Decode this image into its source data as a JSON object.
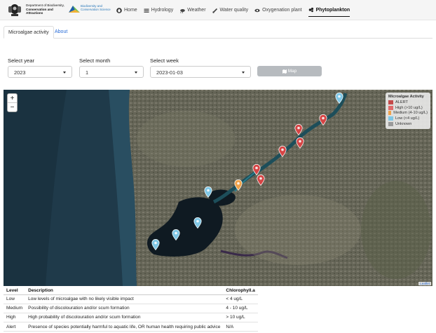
{
  "header": {
    "dept_lines": [
      "Department of Biodiversity,",
      "Conservation and Attractions"
    ],
    "bcs_lines": [
      "Biodiversity and",
      "Conservation Science"
    ],
    "nav": [
      {
        "label": "Home",
        "icon": "home-icon"
      },
      {
        "label": "Hydrology",
        "icon": "hydrology-icon"
      },
      {
        "label": "Weather",
        "icon": "weather-icon"
      },
      {
        "label": "Water quality",
        "icon": "water-quality-icon"
      },
      {
        "label": "Oxygenation plant",
        "icon": "oxygenation-icon"
      },
      {
        "label": "Phytoplankton",
        "icon": "phytoplankton-icon",
        "active": true
      }
    ]
  },
  "tabs": {
    "active": "Microalgae activity",
    "other": "About"
  },
  "filters": {
    "year": {
      "label": "Select year",
      "value": "2023"
    },
    "month": {
      "label": "Select month",
      "value": "1"
    },
    "week": {
      "label": "Select week",
      "value": "2023-01-03"
    },
    "map_button": "Map"
  },
  "map": {
    "zoom_in": "+",
    "zoom_out": "−",
    "attribution": "Leaflet",
    "legend": {
      "title": "Microalgae Activity",
      "items": [
        {
          "label": "ALERT",
          "color": "#c44a4a"
        },
        {
          "label": "High (>10 ug/L)",
          "color": "#e06a6a"
        },
        {
          "label": "Medium (4-10 ug/L)",
          "color": "#f0a24a"
        },
        {
          "label": "Low (<4 ug/L)",
          "color": "#7fc7e6"
        },
        {
          "label": "Unknown",
          "color": "#9a9a9a"
        }
      ]
    },
    "markers": [
      {
        "level": "low"
      },
      {
        "level": "high"
      },
      {
        "level": "high"
      },
      {
        "level": "high"
      },
      {
        "level": "high"
      },
      {
        "level": "high"
      },
      {
        "level": "high"
      },
      {
        "level": "medium"
      },
      {
        "level": "low"
      },
      {
        "level": "low"
      },
      {
        "level": "low"
      },
      {
        "level": "low"
      }
    ]
  },
  "levels_table": {
    "headers": [
      "Level",
      "Description",
      "Chlorophyll.a"
    ],
    "rows": [
      [
        "Low",
        "Low levels of microalgae with no likely visible impact",
        "< 4 ug/L"
      ],
      [
        "Medium",
        "Possibility of discolouration and/or scum formation",
        "4 - 10 ug/L"
      ],
      [
        "High",
        "High probability of discolouration and/or scum formation",
        "> 10 ug/L"
      ],
      [
        "Alert",
        "Presence of species potentially harmful to aquatic life, OR human health requiring public advice",
        "N/A"
      ]
    ]
  }
}
